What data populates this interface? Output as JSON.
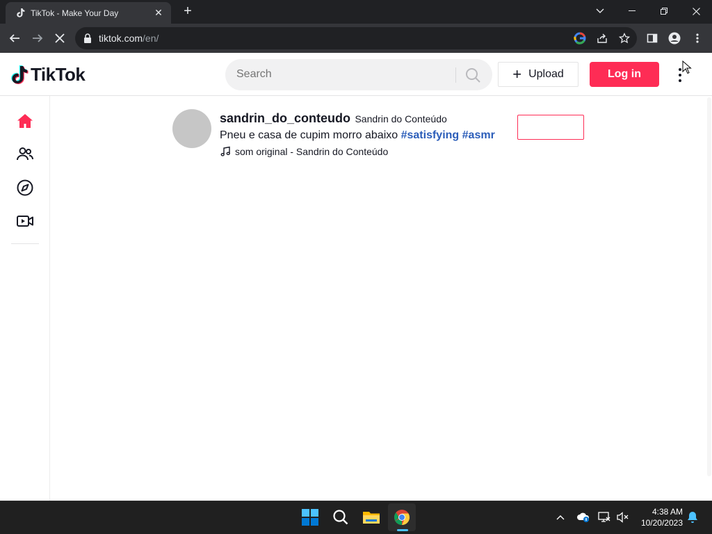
{
  "browser": {
    "tab_title": "TikTok - Make Your Day",
    "url_host": "tiktok.com",
    "url_path": "/en/"
  },
  "header": {
    "logo_text": "TikTok",
    "search_placeholder": "Search",
    "upload_label": "Upload",
    "login_label": "Log in"
  },
  "sidebar": {
    "items": [
      {
        "name": "home",
        "icon": "home-icon",
        "active": true
      },
      {
        "name": "following",
        "icon": "people-icon"
      },
      {
        "name": "explore",
        "icon": "compass-icon"
      },
      {
        "name": "live",
        "icon": "live-camera-icon"
      }
    ]
  },
  "post": {
    "username": "sandrin_do_conteudo",
    "nickname": "Sandrin do Conteúdo",
    "desc_text": "Pneu e casa de cupim morro abaixo",
    "hashtags": [
      "#satisfying",
      "#asmr"
    ],
    "music": "som original - Sandrin do Conteúdo"
  },
  "taskbar": {
    "time": "4:38 AM",
    "date": "10/20/2023"
  },
  "colors": {
    "brand": "#fe2c55",
    "hashtag": "#2b5db9",
    "text": "#161823"
  }
}
